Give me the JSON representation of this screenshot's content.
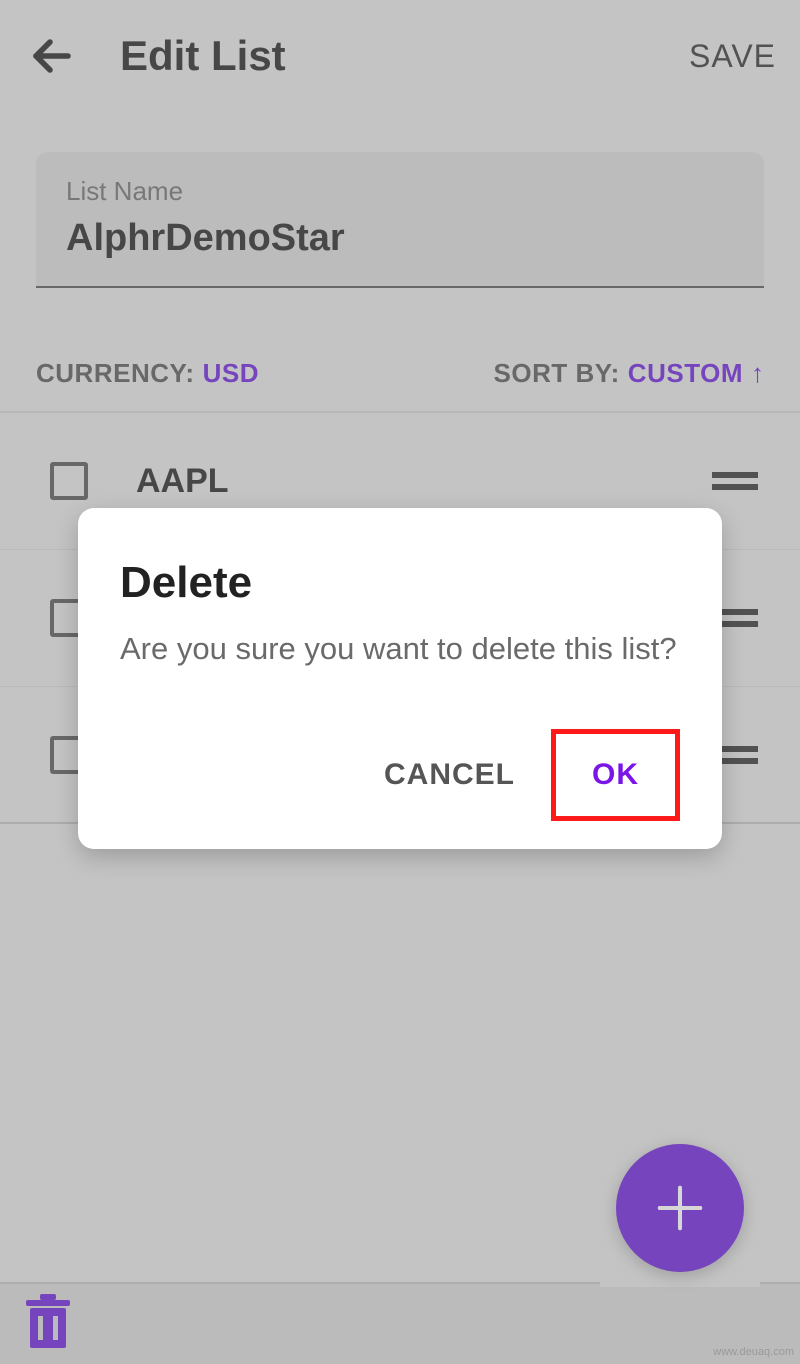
{
  "header": {
    "title": "Edit List",
    "save_label": "SAVE"
  },
  "list_name": {
    "label": "List Name",
    "value": "AlphrDemoStar"
  },
  "options": {
    "currency_label": "CURRENCY:",
    "currency_value": "USD",
    "sort_label": "SORT BY:",
    "sort_value": "CUSTOM",
    "sort_direction": "↑"
  },
  "stocks": [
    {
      "symbol": "AAPL"
    },
    {
      "symbol": ""
    },
    {
      "symbol": ""
    }
  ],
  "dialog": {
    "title": "Delete",
    "message": "Are you sure you want to delete this list?",
    "cancel_label": "CANCEL",
    "ok_label": "OK"
  },
  "watermark": "www.deuaq.com",
  "colors": {
    "accent": "#6b1fd8",
    "highlight": "#ff1a1a"
  }
}
